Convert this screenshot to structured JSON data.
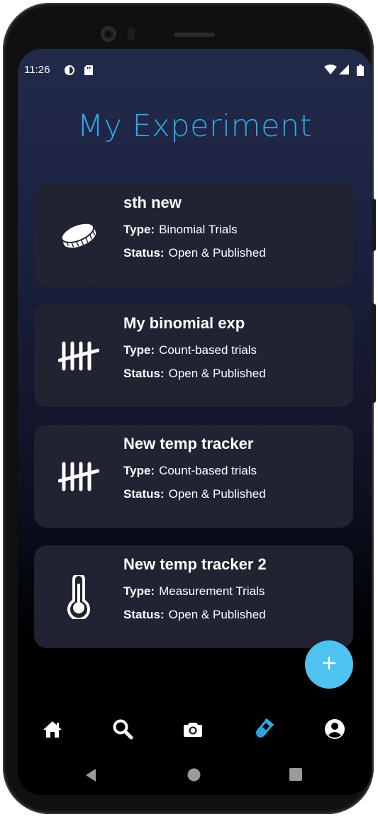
{
  "status_bar": {
    "time": "11:26"
  },
  "page": {
    "title": "My Experiment"
  },
  "experiments": [
    {
      "name": "sth new",
      "type_label": "Type:",
      "type": "Binomial Trials",
      "status_label": "Status:",
      "status": "Open & Published",
      "icon": "coin-icon"
    },
    {
      "name": "My binomial exp",
      "type_label": "Type:",
      "type": "Count-based trials",
      "status_label": "Status:",
      "status": "Open & Published",
      "icon": "tally-icon"
    },
    {
      "name": "New temp tracker",
      "type_label": "Type:",
      "type": "Count-based trials",
      "status_label": "Status:",
      "status": "Open & Published",
      "icon": "tally-icon"
    },
    {
      "name": "New temp tracker 2",
      "type_label": "Type:",
      "type": "Measurement Trials",
      "status_label": "Status:",
      "status": "Open & Published",
      "icon": "thermometer-icon"
    }
  ],
  "fab": {
    "icon": "plus-icon"
  },
  "bottom_nav": [
    {
      "icon": "home-icon",
      "active": false
    },
    {
      "icon": "search-icon",
      "active": false
    },
    {
      "icon": "camera-icon",
      "active": false
    },
    {
      "icon": "test-tube-icon",
      "active": true
    },
    {
      "icon": "account-icon",
      "active": false
    }
  ],
  "colors": {
    "accent": "#2fa8e6",
    "fab": "#4ec3f0",
    "card": "#212333",
    "active_nav": "#2fa8e6"
  }
}
